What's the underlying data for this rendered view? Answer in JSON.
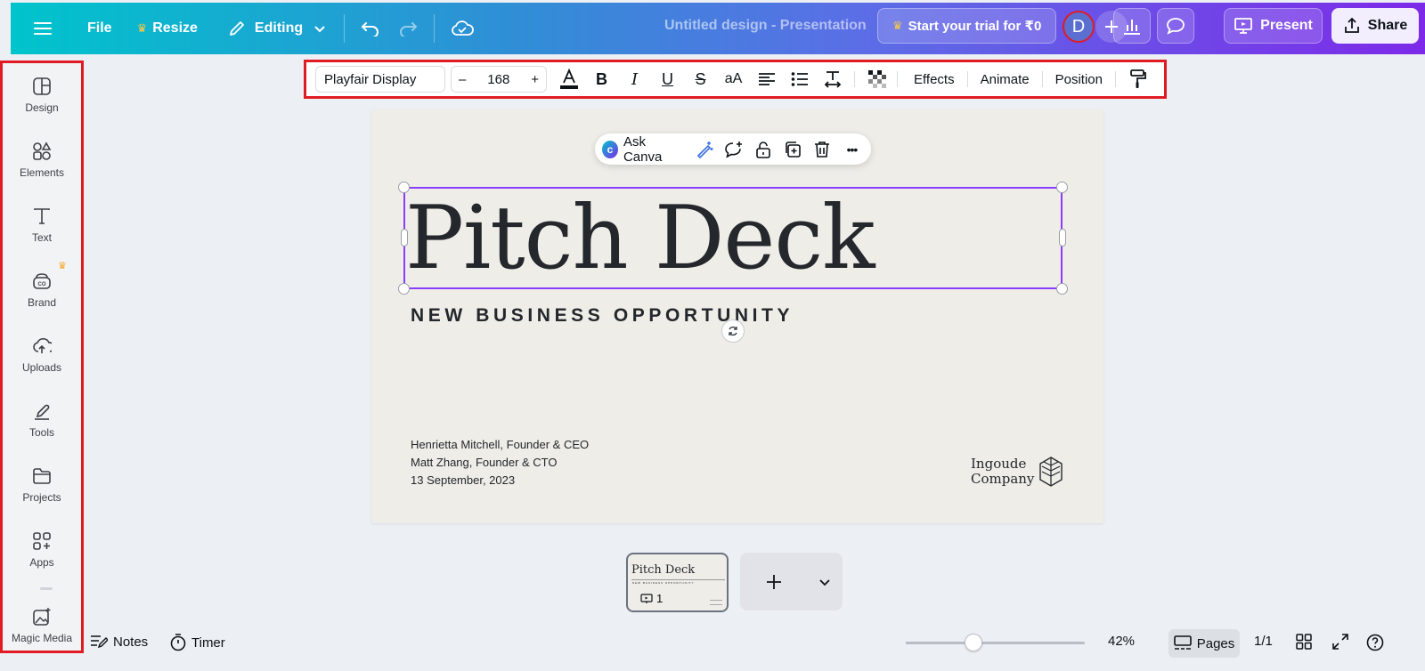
{
  "topbar": {
    "file": "File",
    "resize": "Resize",
    "editing": "Editing",
    "title": "Untitled design - Presentation",
    "trial": "Start your trial for ₹0",
    "avatar_initial": "D",
    "present": "Present",
    "share": "Share"
  },
  "sidebar": {
    "items": [
      {
        "label": "Design",
        "icon": "design-icon"
      },
      {
        "label": "Elements",
        "icon": "elements-icon"
      },
      {
        "label": "Text",
        "icon": "text-icon"
      },
      {
        "label": "Brand",
        "icon": "brand-icon"
      },
      {
        "label": "Uploads",
        "icon": "uploads-icon"
      },
      {
        "label": "Tools",
        "icon": "tools-icon"
      },
      {
        "label": "Projects",
        "icon": "projects-icon"
      },
      {
        "label": "Apps",
        "icon": "apps-icon"
      },
      {
        "label": "Magic Media",
        "icon": "magic-media-icon"
      }
    ]
  },
  "toolbar": {
    "font": "Playfair Display",
    "size_minus": "–",
    "font_size": "168",
    "size_plus": "+",
    "bold": "B",
    "italic": "I",
    "underline": "U",
    "strike": "S",
    "case": "aA",
    "effects": "Effects",
    "animate": "Animate",
    "position": "Position"
  },
  "context_menu": {
    "ask": "Ask Canva",
    "more": "•••"
  },
  "slide": {
    "headline": "Pitch Deck",
    "subline": "NEW BUSINESS OPPORTUNITY",
    "credit_1": "Henrietta Mitchell, Founder & CEO",
    "credit_2": "Matt Zhang, Founder & CTO",
    "credit_3": "13 September, 2023",
    "brand_1": "Ingoude",
    "brand_2": "Company"
  },
  "pages": {
    "thumb_title": "Pitch Deck",
    "thumb_sub": "NEW BUSINESS OPPORTUNITY",
    "thumb_number": "1",
    "add": "+"
  },
  "bottom": {
    "notes": "Notes",
    "timer": "Timer",
    "zoom": "42%",
    "zoom_level": 0.42,
    "pages": "Pages",
    "page_count": "1/1"
  },
  "colors": {
    "accent": "#8b3dff",
    "highlight": "#e01b24",
    "topbar_start": "#00c4cc",
    "topbar_end": "#7d2ae8"
  }
}
